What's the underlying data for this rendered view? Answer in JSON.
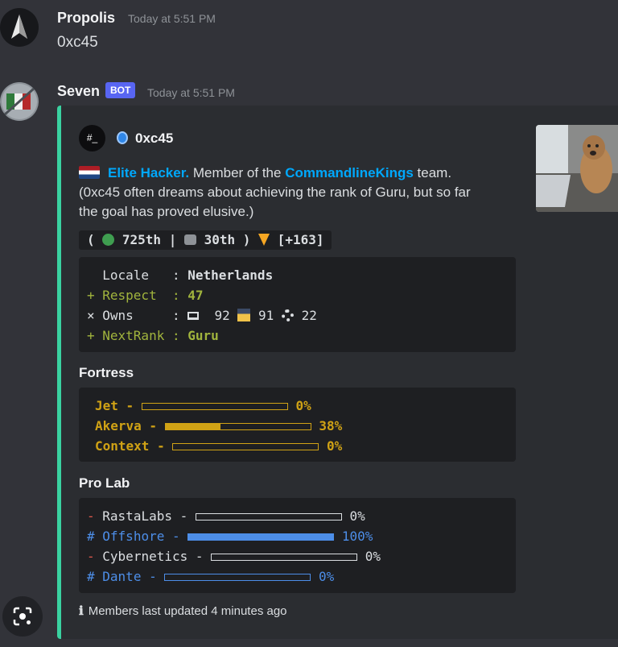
{
  "messages": [
    {
      "username": "Propolis",
      "timestamp": "Today at 5:51 PM",
      "content": "0xc45"
    },
    {
      "username": "Seven",
      "badge": "BOT",
      "timestamp": "Today at 5:51 PM",
      "embed": {
        "accent_color": "#3ad2a1",
        "author": {
          "icon_text": "#_",
          "name": "0xc45"
        },
        "description": {
          "rank": "Elite Hacker.",
          "member_pre": " Member of the ",
          "team": "CommandlineKings",
          "member_post": " team.",
          "dream": "(0xc45 often dreams about achieving the rank of Guru, but so far the goal has proved elusive.)"
        },
        "stats": {
          "open": "( ",
          "global_rank": " 725th",
          "sep": " | ",
          "country_rank": " 30th",
          "close": " ) ",
          "delta": " [+163]"
        },
        "profile": {
          "locale_label": "Locale",
          "locale_value": "Netherlands",
          "respect_label": "Respect",
          "respect_value": "47",
          "owns_label": "Owns",
          "owns_user": "92",
          "owns_root": "91",
          "owns_challenges": "22",
          "nextrank_label": "NextRank",
          "nextrank_value": "Guru"
        },
        "fortress": {
          "title": "Fortress",
          "items": [
            {
              "name": "Jet",
              "pct": "0%",
              "value": 0
            },
            {
              "name": "Akerva",
              "pct": "38%",
              "value": 38
            },
            {
              "name": "Context",
              "pct": "0%",
              "value": 0
            }
          ]
        },
        "prolab": {
          "title": "Pro Lab",
          "items": [
            {
              "marker": "-",
              "name": "RastaLabs",
              "pct": "0%",
              "value": 0
            },
            {
              "marker": "#",
              "name": "Offshore",
              "pct": "100%",
              "value": 100
            },
            {
              "marker": "-",
              "name": "Cybernetics",
              "pct": "0%",
              "value": 0
            },
            {
              "marker": "#",
              "name": "Dante",
              "pct": "0%",
              "value": 0
            }
          ]
        },
        "footer": "Members last updated 4 minutes ago"
      }
    }
  ]
}
